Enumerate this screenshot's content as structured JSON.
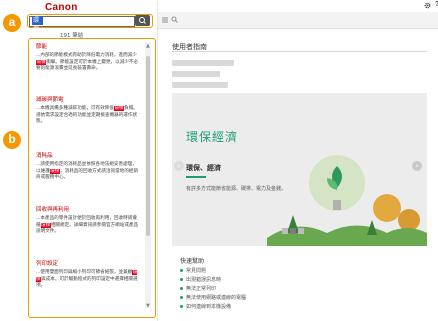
{
  "brand": {
    "logo": "Canon"
  },
  "callouts": {
    "a": "a",
    "b": "b"
  },
  "search": {
    "value": "環保",
    "count": "191 筆結"
  },
  "results": [
    {
      "title": "節能",
      "snippet_before": "...內部的節能模式有助於降低電力消耗，進而減少",
      "snippet_hl": "環保",
      "snippet_after": "衝擊。節能設定可於本機上變更，以減少不必要的能源浪費並延長裝置壽命。"
    },
    {
      "title": "減碳與節電",
      "snippet_before": "...本機具備多種減碳功能，可有效降低",
      "snippet_hl": "環保",
      "snippet_after": "負擔。請依需求設定合適的功能並定期檢查機器的運作狀態。"
    },
    {
      "title": "消耗品",
      "snippet_before": "...請使用指定的消耗品並依照各地法規妥善處理，以維護",
      "snippet_hl": "環保",
      "snippet_after": "。消耗品的回收方式請洽詢當地的經銷商或服務中心。"
    },
    {
      "title": "回收與再利用",
      "snippet_before": "...本產品的零件設計便於回收再利用，回收時請遵循",
      "snippet_hl": "環保",
      "snippet_after": "相關規定。詳細資訊請參閱官方網站或產品說明文件。"
    },
    {
      "title": "列印設定",
      "snippet_before": "...使用雙面列印與縮小列印可節省紙張，並兼顧",
      "snippet_hl": "環保",
      "snippet_after": "與成本。可於驅動程式的列印設定中選擇相關選項。"
    }
  ],
  "page": {
    "title": "使用者指南"
  },
  "banner": {
    "title": "環保經濟",
    "subtitle": "環保、經濟",
    "text": "有許多方式能節省能源、碳排、電力及金錢。",
    "prev": "‹",
    "next": "›"
  },
  "quick": {
    "title": "快速幫助",
    "items": [
      "常見問題",
      "出現錯誤訊息時",
      "無法正常列印",
      "無法使用網路或連線的電腦",
      "如何連線到本機設備"
    ]
  },
  "colors": {
    "accent": "#f39800",
    "brand": "#c00000",
    "highlight": "#e9001b",
    "green": "#1c9c77"
  },
  "icons": {
    "search": "search-icon",
    "settings": "gear-icon",
    "help": "help-icon",
    "menu": "menu-icon"
  }
}
